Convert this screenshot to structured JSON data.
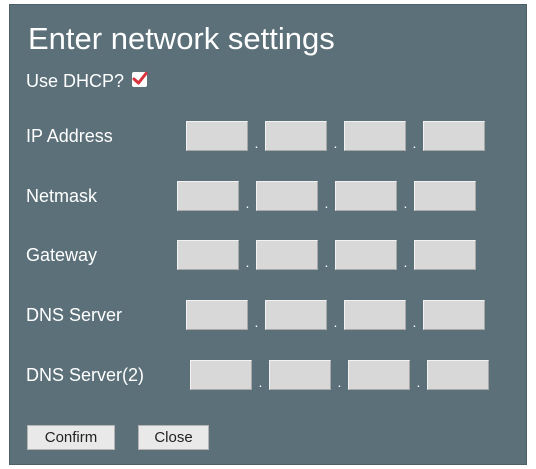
{
  "title": "Enter network settings",
  "dhcp": {
    "label": "Use DHCP?",
    "checked": true,
    "check_color": "#d9323d"
  },
  "fields": [
    {
      "label": "IP Address",
      "values": [
        "",
        "",
        "",
        ""
      ]
    },
    {
      "label": "Netmask",
      "values": [
        "",
        "",
        "",
        ""
      ]
    },
    {
      "label": "Gateway",
      "values": [
        "",
        "",
        "",
        ""
      ]
    },
    {
      "label": "DNS Server",
      "values": [
        "",
        "",
        "",
        ""
      ]
    },
    {
      "label": "DNS Server(2)",
      "values": [
        "",
        "",
        "",
        ""
      ]
    }
  ],
  "separator": ".",
  "buttons": {
    "confirm": "Confirm",
    "close": "Close"
  },
  "colors": {
    "panel": "#5b7079",
    "input": "#d8d8d8",
    "text": "#ffffff"
  }
}
